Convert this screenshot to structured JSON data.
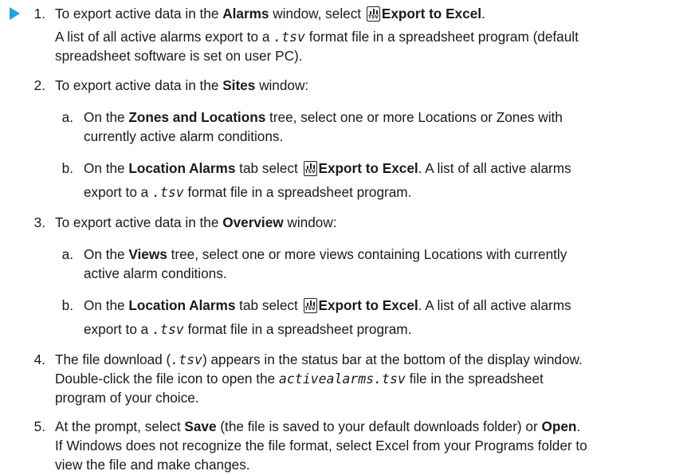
{
  "steps": [
    {
      "num": "1.",
      "a": "To export active data in the ",
      "b": "Alarms",
      "c": " window, select ",
      "d": "Export to Excel",
      "e": ".",
      "p1": "A list of all active alarms export to a ",
      "mono": ".tsv",
      "p2": " format file in a spreadsheet program (default",
      "p3": "spreadsheet software is set on user PC)."
    },
    {
      "num": "2.",
      "a": "To export active data in the ",
      "b": "Sites",
      "c": " window:",
      "subs": [
        {
          "letter": "a.",
          "a": "On the ",
          "b": "Zones and Locations",
          "c": " tree, select one or more Locations or Zones with",
          "d": "currently active alarm conditions."
        },
        {
          "letter": "b.",
          "a": "On the ",
          "b": "Location Alarms",
          "c": " tab select ",
          "d": "Export to Excel",
          "e": ". A list of all active alarms",
          "f": "export to a ",
          "mono": ".tsv",
          "g": " format file in a spreadsheet program."
        }
      ]
    },
    {
      "num": "3.",
      "a": "To export active data in the ",
      "b": "Overview",
      "c": " window:",
      "subs": [
        {
          "letter": "a.",
          "a": "On the ",
          "b": "Views",
          "c": " tree, select one or more views containing Locations with currently",
          "d": "active alarm conditions."
        },
        {
          "letter": "b.",
          "a": "On the ",
          "b": "Location Alarms",
          "c": " tab select ",
          "d": "Export to Excel",
          "e": ". A list of all active alarms",
          "f": "export to a ",
          "mono": ".tsv",
          "g": " format file in a spreadsheet program."
        }
      ]
    },
    {
      "num": "4.",
      "a": "The file download (",
      "mono": ".tsv",
      "b": ") appears in the status bar at the bottom of the display window.",
      "c": "Double-click the file icon to open the ",
      "mono2": "activealarms.tsv",
      "d": " file in the spreadsheet",
      "e": "program of your choice."
    },
    {
      "num": "5.",
      "a": "At the prompt, select ",
      "b": "Save",
      "c": " (the file is saved to your default downloads folder) or ",
      "d": "Open",
      "e": ".",
      "f": "If Windows does not recognize the file format, select Excel from your Programs folder to",
      "g": "view the file and make changes."
    }
  ],
  "icon": {
    "name": "export-excel-icon",
    "caption": "TSV"
  }
}
